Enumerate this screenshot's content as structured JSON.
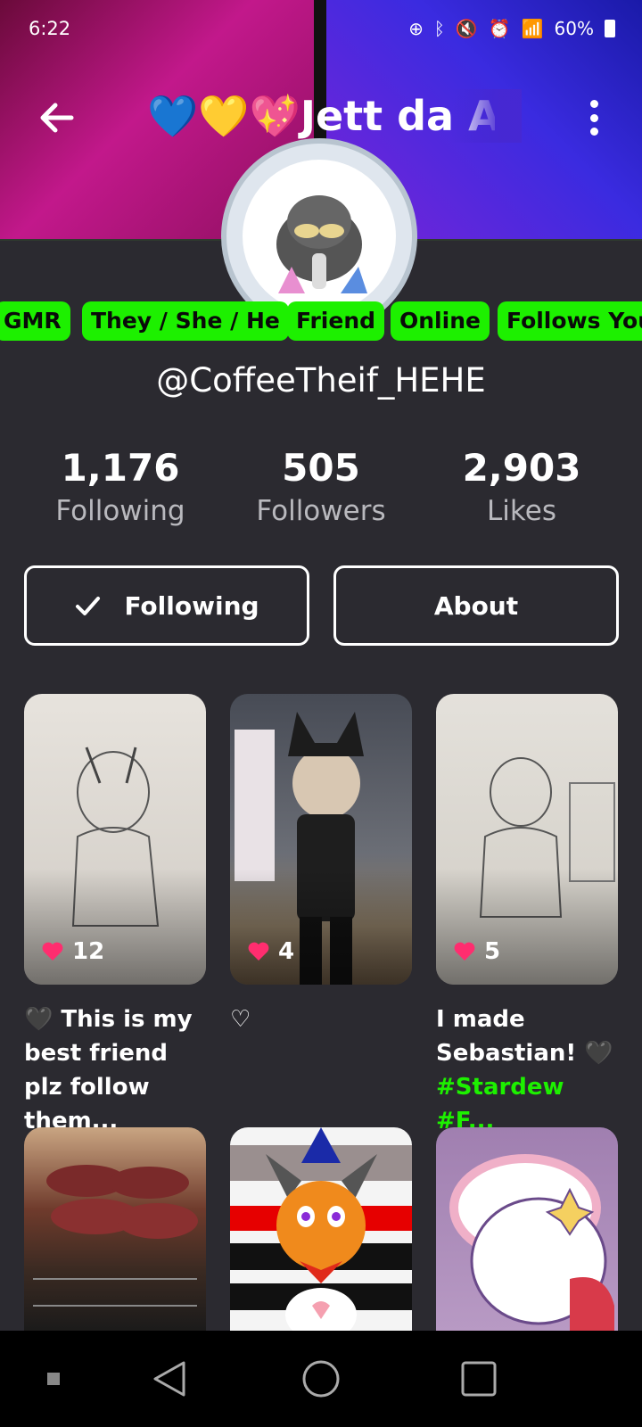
{
  "status_bar": {
    "time": "6:22",
    "battery": "60%"
  },
  "header": {
    "title": "💙💛💖Jett da A",
    "back_icon": "arrow-left-icon",
    "more_icon": "more-vert-icon"
  },
  "tags": [
    "GMR",
    "They / She / He",
    "Friend",
    "Online",
    "Follows You"
  ],
  "profile": {
    "handle": "@CoffeeTheif_HEHE"
  },
  "stats": [
    {
      "value": "1,176",
      "label": "Following"
    },
    {
      "value": "505",
      "label": "Followers"
    },
    {
      "value": "2,903",
      "label": "Likes"
    }
  ],
  "actions": {
    "following_label": "Following",
    "about_label": "About"
  },
  "posts": [
    {
      "likes": "12",
      "caption": "🖤 This is my best friend plz follow them...",
      "hashtags": ""
    },
    {
      "likes": "4",
      "caption": "♡",
      "hashtags": ""
    },
    {
      "likes": "5",
      "caption": "I made Sebastian! 🖤",
      "hashtags": "#Stardew #F..."
    },
    {
      "likes": "",
      "caption": "",
      "hashtags": ""
    },
    {
      "likes": "",
      "caption": "",
      "hashtags": ""
    },
    {
      "likes": "",
      "caption": "",
      "hashtags": ""
    }
  ],
  "colors": {
    "tag_green": "#1df000",
    "background": "#2b2a30",
    "heart_pink": "#ff2d6f"
  }
}
